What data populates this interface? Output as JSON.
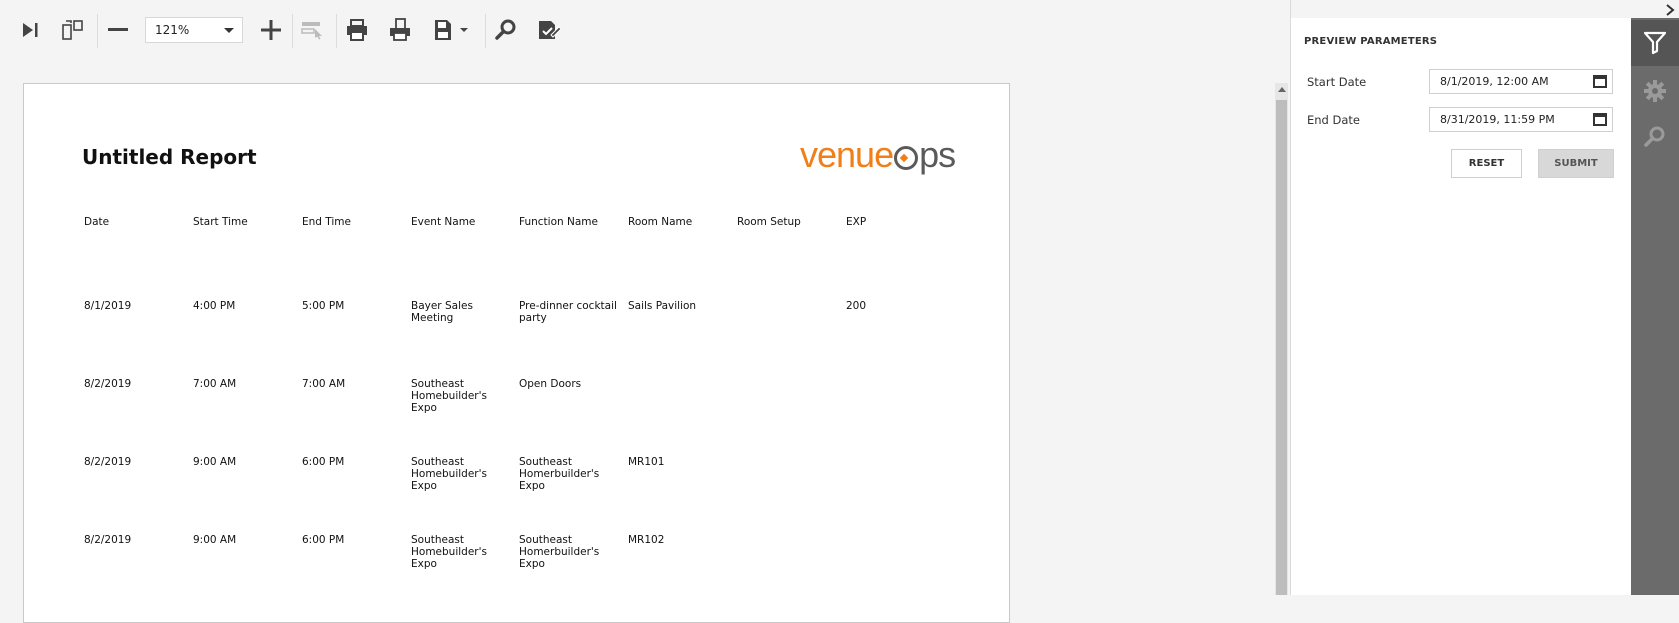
{
  "toolbar": {
    "zoom_value": "121%",
    "icons": [
      "first-page-icon",
      "multipage-icon",
      "zoom-out-icon",
      "zoom-in-icon",
      "highlight-editing-icon",
      "print-icon",
      "print-page-icon",
      "export-icon",
      "search-icon",
      "editing-fields-icon"
    ]
  },
  "report": {
    "title": "Untitled Report",
    "logo_main": "venue",
    "logo_tail": "ps",
    "columns": [
      "Date",
      "Start Time",
      "End Time",
      "Event Name",
      "Function Name",
      "Room Name",
      "Room Setup",
      "EXP"
    ],
    "rows": [
      {
        "date": "8/1/2019",
        "start": "4:00 PM",
        "end": "5:00 PM",
        "event": "Bayer Sales Meeting",
        "function": "Pre-dinner cocktail party",
        "room": "Sails Pavilion",
        "setup": "",
        "exp": "200"
      },
      {
        "date": "8/2/2019",
        "start": "7:00 AM",
        "end": "7:00 AM",
        "event": "Southeast Homebuilder's Expo",
        "function": "Open Doors",
        "room": "",
        "setup": "",
        "exp": ""
      },
      {
        "date": "8/2/2019",
        "start": "9:00 AM",
        "end": "6:00 PM",
        "event": "Southeast Homebuilder's Expo",
        "function": "Southeast Homerbuilder's Expo",
        "room": "MR101",
        "setup": "",
        "exp": ""
      },
      {
        "date": "8/2/2019",
        "start": "9:00 AM",
        "end": "6:00 PM",
        "event": "Southeast Homebuilder's Expo",
        "function": "Southeast Homerbuilder's Expo",
        "room": "MR102",
        "setup": "",
        "exp": ""
      }
    ]
  },
  "panel": {
    "title": "PREVIEW PARAMETERS",
    "start_label": "Start Date",
    "start_value": "8/1/2019, 12:00 AM",
    "end_label": "End Date",
    "end_value": "8/31/2019, 11:59 PM",
    "reset_label": "RESET",
    "submit_label": "SUBMIT"
  },
  "sidebar": {
    "items": [
      "filter-icon",
      "gear-icon",
      "search-icon"
    ],
    "active": "filter-icon"
  },
  "colors": {
    "accent_orange": "#f07f1a",
    "sidebar_bg": "#6b6b6b",
    "sidebar_active": "#555555"
  }
}
